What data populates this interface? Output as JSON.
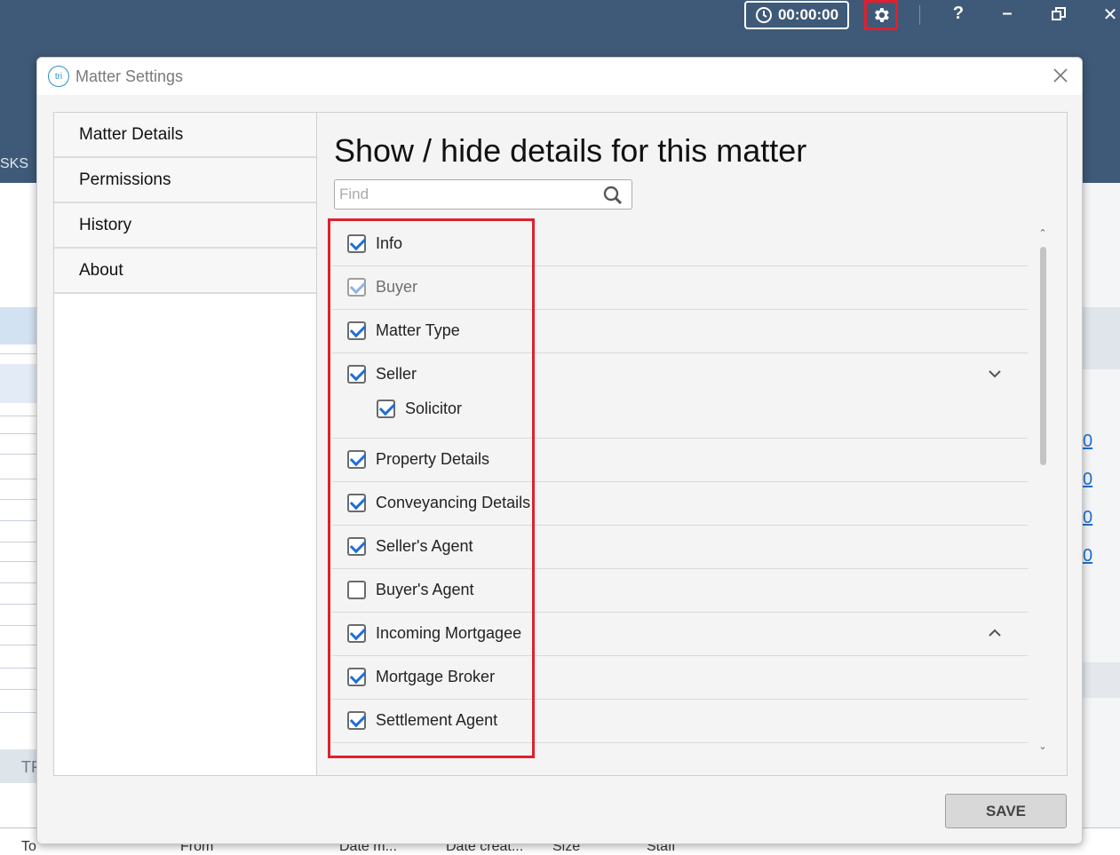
{
  "app": {
    "timer": "00:00:00",
    "bg_partial_label": "SKS",
    "bg_right_links": [
      "0",
      "0",
      "0",
      "0"
    ],
    "bg_bottom_columns": [
      "To",
      "From",
      "Date m...",
      "Date creat...",
      "Size",
      "Staff"
    ],
    "bg_left_fragment": "TF"
  },
  "dialog": {
    "title": "Matter Settings",
    "app_logo_text": "tri",
    "heading": "Show / hide details for this matter",
    "find_placeholder": "Find",
    "save_label": "SAVE"
  },
  "nav": {
    "items": [
      {
        "label": "Matter Details"
      },
      {
        "label": "Permissions"
      },
      {
        "label": "History"
      },
      {
        "label": "About"
      }
    ]
  },
  "details": {
    "items": [
      {
        "label": "Info",
        "checked": true
      },
      {
        "label": "Buyer",
        "checked": true,
        "disabled": true
      },
      {
        "label": "Matter Type",
        "checked": true
      },
      {
        "label": "Seller",
        "checked": true,
        "expand": "collapsed-chevron-down",
        "sub": [
          {
            "label": "Solicitor",
            "checked": true
          }
        ]
      },
      {
        "label": "Property Details",
        "checked": true
      },
      {
        "label": "Conveyancing Details",
        "checked": true
      },
      {
        "label": "Seller's Agent",
        "checked": true
      },
      {
        "label": "Buyer's Agent",
        "checked": false
      },
      {
        "label": "Incoming Mortgagee",
        "checked": true,
        "expand": "chevron-up"
      },
      {
        "label": "Mortgage Broker",
        "checked": true
      },
      {
        "label": "Settlement Agent",
        "checked": true
      }
    ]
  },
  "colors": {
    "topbar": "#3f5a78",
    "highlight": "#e0202c",
    "checkmark": "#1e6fd9"
  }
}
